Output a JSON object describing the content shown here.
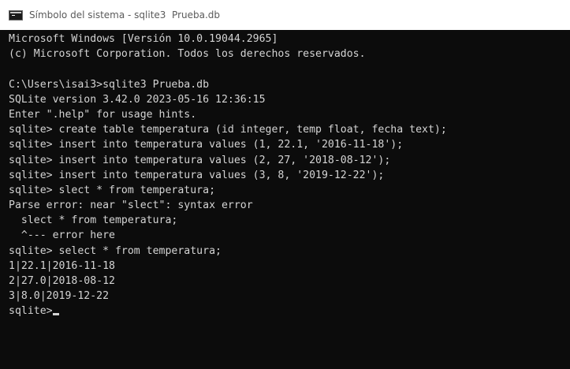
{
  "window": {
    "title": "Símbolo del sistema - sqlite3  Prueba.db",
    "icon": "console-icon"
  },
  "console": {
    "lines": [
      "Microsoft Windows [Versión 10.0.19044.2965]",
      "(c) Microsoft Corporation. Todos los derechos reservados.",
      "",
      "C:\\Users\\isai3>sqlite3 Prueba.db",
      "SQLite version 3.42.0 2023-05-16 12:36:15",
      "Enter \".help\" for usage hints.",
      "sqlite> create table temperatura (id integer, temp float, fecha text);",
      "sqlite> insert into temperatura values (1, 22.1, '2016-11-18');",
      "sqlite> insert into temperatura values (2, 27, '2018-08-12');",
      "sqlite> insert into temperatura values (3, 8, '2019-12-22');",
      "sqlite> slect * from temperatura;",
      "Parse error: near \"slect\": syntax error",
      "  slect * from temperatura;",
      "  ^--- error here",
      "sqlite> select * from temperatura;",
      "1|22.1|2016-11-18",
      "2|27.0|2018-08-12",
      "3|8.0|2019-12-22"
    ],
    "prompt": "sqlite>"
  }
}
